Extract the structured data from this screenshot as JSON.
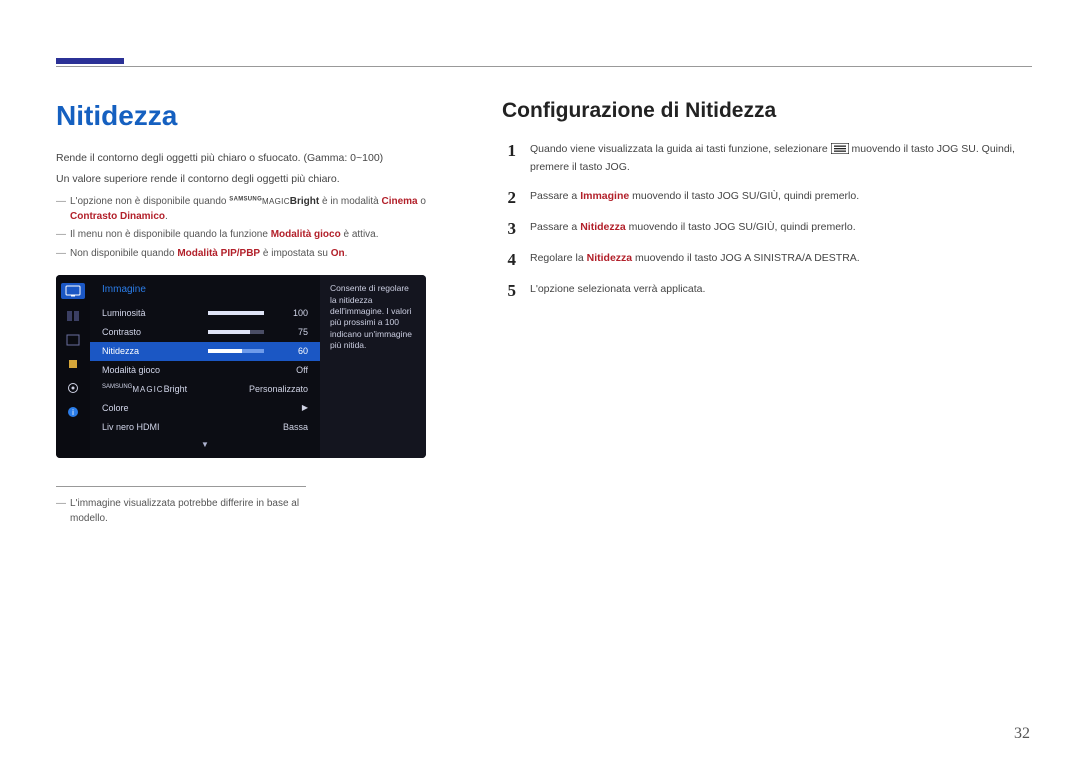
{
  "page_number": "32",
  "left": {
    "title": "Nitidezza",
    "para1": "Rende il contorno degli oggetti più chiaro o sfuocato. (Gamma: 0~100)",
    "para2": "Un valore superiore rende il contorno degli oggetti più chiaro.",
    "note1_pre": "L'opzione non è disponibile quando ",
    "note1_magic_sup": "SAMSUNG",
    "note1_magic": "MAGIC",
    "note1_bright": "Bright",
    "note1_mid": " è in modalità ",
    "note1_cinema": "Cinema",
    "note1_or": " o ",
    "note1_contrast": "Contrasto Dinamico",
    "note1_dot": ".",
    "note2_pre": "Il menu non è disponibile quando la funzione ",
    "note2_mode": "Modalità gioco",
    "note2_post": " è attiva.",
    "note3_pre": "Non disponibile quando ",
    "note3_mode": "Modalità PIP/PBP",
    "note3_mid": " è impostata su ",
    "note3_on": "On",
    "note3_dot": ".",
    "foot": "L'immagine visualizzata potrebbe differire in base al modello."
  },
  "osd": {
    "title": "Immagine",
    "rows": [
      {
        "label": "Luminosità",
        "val": "100",
        "fill": 100,
        "type": "bar"
      },
      {
        "label": "Contrasto",
        "val": "75",
        "fill": 75,
        "type": "bar"
      },
      {
        "label": "Nitidezza",
        "val": "60",
        "fill": 60,
        "type": "bar",
        "sel": true
      },
      {
        "label": "Modalità gioco",
        "valtxt": "Off",
        "type": "text"
      },
      {
        "label": "MAGICBright",
        "sup": "SAMSUNG",
        "valtxt": "Personalizzato",
        "type": "magic"
      },
      {
        "label": "Colore",
        "type": "arrow"
      },
      {
        "label": "Liv nero HDMI",
        "valtxt": "Bassa",
        "type": "text"
      }
    ],
    "side": "Consente di regolare la nitidezza dell'immagine. I valori più prossimi a 100 indicano un'immagine più nitida."
  },
  "right": {
    "title": "Configurazione di Nitidezza",
    "steps": {
      "s1a": "Quando viene visualizzata la guida ai tasti funzione, selezionare ",
      "s1b": " muovendo il tasto JOG SU. Quindi, premere il tasto JOG.",
      "s2a": "Passare a ",
      "s2_em": "Immagine",
      "s2b": " muovendo il tasto JOG SU/GIÙ, quindi premerlo.",
      "s3a": "Passare a ",
      "s3_em": "Nitidezza",
      "s3b": " muovendo il tasto JOG SU/GIÙ, quindi premerlo.",
      "s4a": "Regolare la ",
      "s4_em": "Nitidezza",
      "s4b": " muovendo il tasto JOG A SINISTRA/A DESTRA.",
      "s5": "L'opzione selezionata verrà applicata."
    },
    "nums": {
      "n1": "1",
      "n2": "2",
      "n3": "3",
      "n4": "4",
      "n5": "5"
    }
  }
}
